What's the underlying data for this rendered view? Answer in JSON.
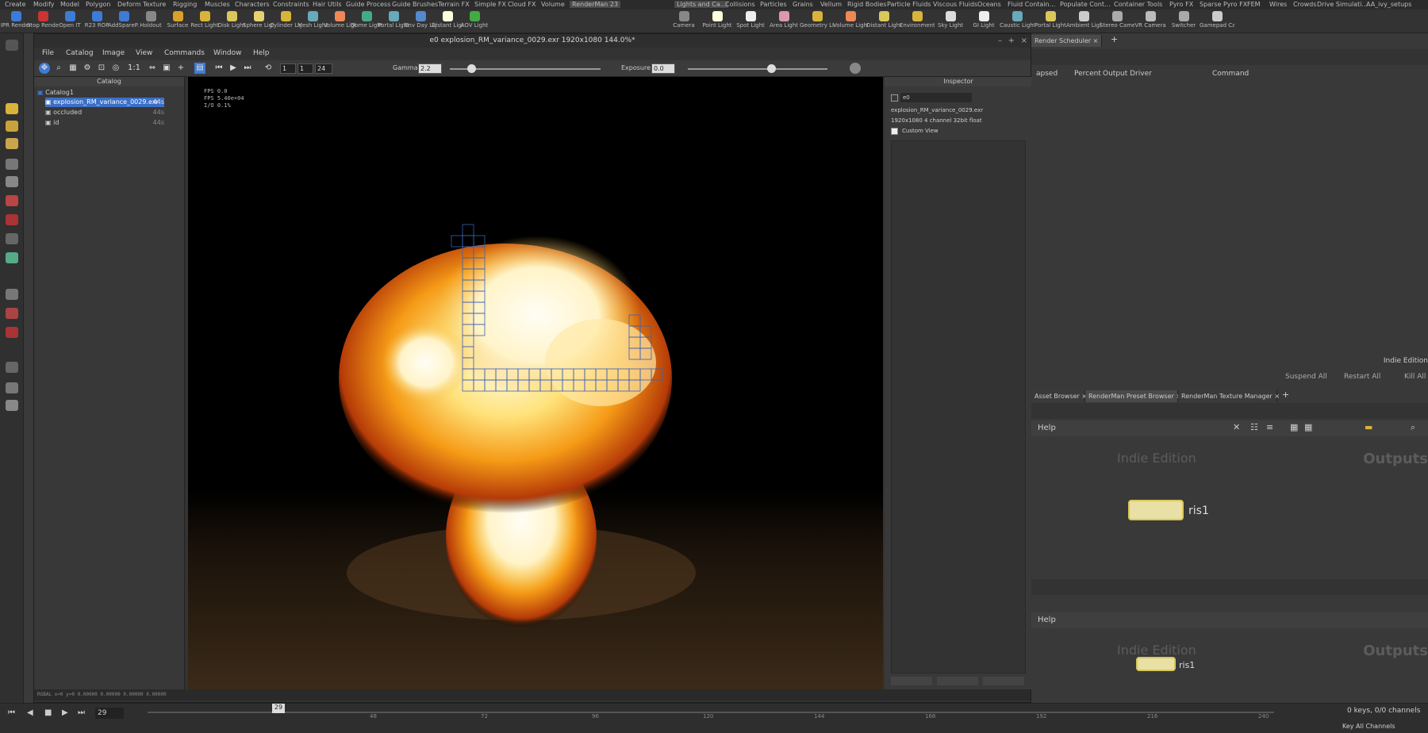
{
  "shelf_tabs": [
    "Create",
    "Modify",
    "Model",
    "Polygon",
    "Deform",
    "Texture",
    "Rigging",
    "Muscles",
    "Characters",
    "Constraints",
    "Hair Utils",
    "Guide Process",
    "Guide Brushes",
    "Terrain FX",
    "Simple FX",
    "Cloud FX",
    "Volume",
    "RenderMan 23",
    "Lights and Ca...",
    "Collisions",
    "Particles",
    "Grains",
    "Vellum",
    "Rigid Bodies",
    "Particle Fluids",
    "Viscous Fluids",
    "Oceans",
    "Fluid Contain...",
    "Populate Cont...",
    "Container Tools",
    "Pyro FX",
    "Sparse Pyro FX",
    "FEM",
    "Wires",
    "Crowds",
    "Drive Simulati...",
    "AA_ivy_setups"
  ],
  "shelf_tools_left": [
    "IPR Render",
    "Stop Render",
    "Open IT",
    "R23 ROP",
    "AddSpareP...",
    "Holdout",
    "Surface",
    "Rect Light",
    "Disk Light",
    "Sphere Light",
    "Cylinder Light",
    "Mesh Light",
    "Volume Light",
    "Dome Light",
    "Portal Light",
    "Env Day Light",
    "Distant Light",
    "AOV Light"
  ],
  "shelf_tools_right": [
    "Camera",
    "Point Light",
    "Spot Light",
    "Area Light",
    "Geometry Light",
    "Volume Light",
    "Distant Light",
    "Environment Light",
    "Sky Light",
    "GI Light",
    "Caustic Light",
    "Portal Light",
    "Ambient Light",
    "Stereo Camera",
    "VR Camera",
    "Switcher",
    "Gamepad Camera"
  ],
  "window": {
    "title": "e0 explosion_RM_variance_0029.exr 1920x1080 144.0%*"
  },
  "menu": [
    "File",
    "Catalog",
    "Image",
    "View",
    "Commands",
    "Window",
    "Help"
  ],
  "toolbar": {
    "ratio": "1:1",
    "frame_start": "1",
    "frame_current": "1",
    "frame_end": "24",
    "gamma_label": "Gamma",
    "gamma_value": "2.2",
    "exposure_label": "Exposure",
    "exposure_value": "0.0"
  },
  "catalog": {
    "title": "Catalog",
    "root": "Catalog1",
    "items": [
      {
        "label": "explosion_RM_variance_0029.exr",
        "tag": "44s",
        "selected": true
      },
      {
        "label": "occluded",
        "tag": "44s"
      },
      {
        "label": "id",
        "tag": "44s"
      }
    ]
  },
  "hud": {
    "line1": "FPS 0.0",
    "line2": "FPS 5.40e+04",
    "line3": "I/O 0.1%"
  },
  "inspector": {
    "title": "Inspector",
    "field": "e0",
    "filename": "explosion_RM_variance_0029.exr",
    "info": "1920x1080 4 channel 32bit float",
    "custom_view": "Custom View"
  },
  "status_line": "RGBAL   x=0 y=0   0.00000 0.00000 0.00000 0.00000",
  "right": {
    "tab_scheduler": "Render Scheduler",
    "cols": [
      "apsed",
      "Percent",
      "Output Driver",
      "Command"
    ],
    "indie": "Indie Edition",
    "actions": [
      "Suspend All",
      "Restart All",
      "Kill All"
    ],
    "tabs2": [
      "Asset Browser",
      "RenderMan Preset Browser",
      "RenderMan Texture Manager"
    ],
    "help": "Help",
    "net_label": "Indie Edition",
    "outputs": "Outputs",
    "node_name": "ris1"
  },
  "timeline": {
    "frame": "29",
    "marker": "29",
    "ticks": [
      "48",
      "72",
      "96",
      "120",
      "144",
      "168",
      "192",
      "216",
      "240"
    ],
    "keys": "0 keys, 0/0 channels",
    "key_all": "Key All Channels"
  },
  "colors": {
    "accent": "#3d7bd6",
    "selection": "#3b6fc7",
    "node_fill": "#e8e0a4"
  }
}
